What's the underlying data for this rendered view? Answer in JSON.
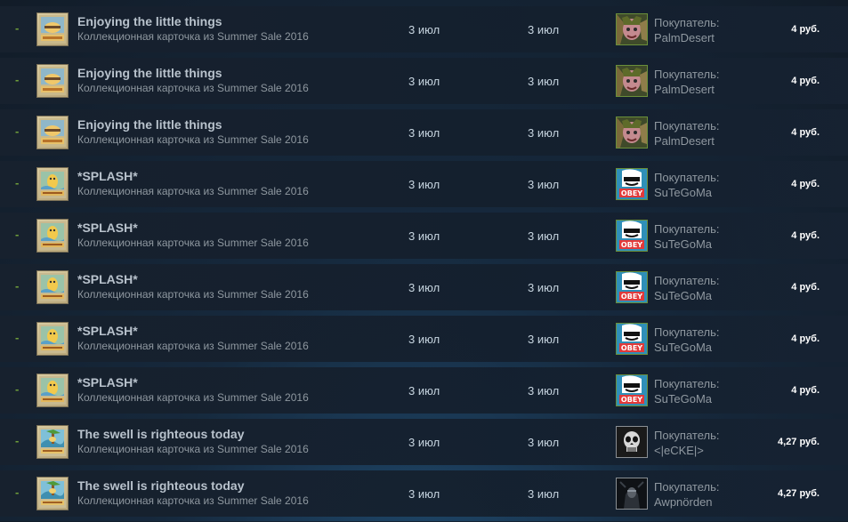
{
  "rows": [
    {
      "status": "-",
      "card_icon": "enjoying-card-icon",
      "item_name": "Enjoying the little things",
      "item_game": "Коллекционная карточка из Summer Sale 2016",
      "listed_date": "3 июл",
      "sold_date": "3 июл",
      "buyer_avatar": "palmdesert-avatar",
      "buyer_label": "Покупатель:",
      "buyer_name": "PalmDesert",
      "price": "4 руб."
    },
    {
      "status": "-",
      "card_icon": "enjoying-card-icon",
      "item_name": "Enjoying the little things",
      "item_game": "Коллекционная карточка из Summer Sale 2016",
      "listed_date": "3 июл",
      "sold_date": "3 июл",
      "buyer_avatar": "palmdesert-avatar",
      "buyer_label": "Покупатель:",
      "buyer_name": "PalmDesert",
      "price": "4 руб."
    },
    {
      "status": "-",
      "card_icon": "enjoying-card-icon",
      "item_name": "Enjoying the little things",
      "item_game": "Коллекционная карточка из Summer Sale 2016",
      "listed_date": "3 июл",
      "sold_date": "3 июл",
      "buyer_avatar": "palmdesert-avatar",
      "buyer_label": "Покупатель:",
      "buyer_name": "PalmDesert",
      "price": "4 руб."
    },
    {
      "status": "-",
      "card_icon": "splash-card-icon",
      "item_name": "*SPLASH*",
      "item_game": "Коллекционная карточка из Summer Sale 2016",
      "listed_date": "3 июл",
      "sold_date": "3 июл",
      "buyer_avatar": "sutegoma-avatar",
      "buyer_label": "Покупатель:",
      "buyer_name": "SuTeGoMa",
      "price": "4 руб."
    },
    {
      "status": "-",
      "card_icon": "splash-card-icon",
      "item_name": "*SPLASH*",
      "item_game": "Коллекционная карточка из Summer Sale 2016",
      "listed_date": "3 июл",
      "sold_date": "3 июл",
      "buyer_avatar": "sutegoma-avatar",
      "buyer_label": "Покупатель:",
      "buyer_name": "SuTeGoMa",
      "price": "4 руб."
    },
    {
      "status": "-",
      "card_icon": "splash-card-icon",
      "item_name": "*SPLASH*",
      "item_game": "Коллекционная карточка из Summer Sale 2016",
      "listed_date": "3 июл",
      "sold_date": "3 июл",
      "buyer_avatar": "sutegoma-avatar",
      "buyer_label": "Покупатель:",
      "buyer_name": "SuTeGoMa",
      "price": "4 руб."
    },
    {
      "status": "-",
      "card_icon": "splash-card-icon",
      "item_name": "*SPLASH*",
      "item_game": "Коллекционная карточка из Summer Sale 2016",
      "listed_date": "3 июл",
      "sold_date": "3 июл",
      "buyer_avatar": "sutegoma-avatar",
      "buyer_label": "Покупатель:",
      "buyer_name": "SuTeGoMa",
      "price": "4 руб."
    },
    {
      "status": "-",
      "card_icon": "splash-card-icon",
      "item_name": "*SPLASH*",
      "item_game": "Коллекционная карточка из Summer Sale 2016",
      "listed_date": "3 июл",
      "sold_date": "3 июл",
      "buyer_avatar": "sutegoma-avatar",
      "buyer_label": "Покупатель:",
      "buyer_name": "SuTeGoMa",
      "price": "4 руб."
    },
    {
      "status": "-",
      "card_icon": "swell-card-icon",
      "item_name": "The swell is righteous today",
      "item_game": "Коллекционная карточка из Summer Sale 2016",
      "listed_date": "3 июл",
      "sold_date": "3 июл",
      "buyer_avatar": "skull-avatar",
      "buyer_label": "Покупатель:",
      "buyer_name": "<|eCKE|>",
      "price": "4,27 руб."
    },
    {
      "status": "-",
      "card_icon": "swell-card-icon",
      "item_name": "The swell is righteous today",
      "item_game": "Коллекционная карточка из Summer Sale 2016",
      "listed_date": "3 июл",
      "sold_date": "3 июл",
      "buyer_avatar": "dark-figure-avatar",
      "buyer_label": "Покупатель:",
      "buyer_name": "Awpnörden",
      "price": "4,27 руб."
    }
  ],
  "colors": {
    "row_bg": "#16202d",
    "status_dash": "#6f9e3b",
    "item_name": "#b8c2cc",
    "muted_text": "#8f98a0",
    "price": "#ffffff",
    "avatar_border_online": "#6a8f3a"
  }
}
